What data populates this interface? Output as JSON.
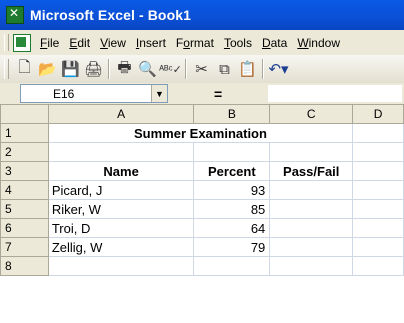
{
  "window": {
    "title": "Microsoft Excel - Book1"
  },
  "menu": [
    "File",
    "Edit",
    "View",
    "Insert",
    "Format",
    "Tools",
    "Data",
    "Window"
  ],
  "menu_underline": [
    "F",
    "E",
    "V",
    "I",
    "o",
    "T",
    "D",
    "W"
  ],
  "toolbar": {
    "icons": [
      "new-icon",
      "open-icon",
      "save-icon",
      "permission-icon",
      "print-icon",
      "print-preview-icon",
      "spelling-icon",
      "cut-icon",
      "copy-icon",
      "paste-icon",
      "undo-icon"
    ]
  },
  "formula_bar": {
    "name_box": "E16",
    "fx": "=",
    "formula": ""
  },
  "columns": [
    "A",
    "B",
    "C",
    "D"
  ],
  "rows": [
    "1",
    "2",
    "3",
    "4",
    "5",
    "6",
    "7",
    "8"
  ],
  "sheet": {
    "title": "Summer Examination",
    "headers": {
      "name": "Name",
      "percent": "Percent",
      "passfail": "Pass/Fail"
    },
    "students": [
      {
        "name": "Picard, J",
        "percent": "93",
        "passfail": ""
      },
      {
        "name": "Riker, W",
        "percent": "85",
        "passfail": ""
      },
      {
        "name": "Troi, D",
        "percent": "64",
        "passfail": ""
      },
      {
        "name": "Zellig, W",
        "percent": "79",
        "passfail": ""
      }
    ]
  }
}
